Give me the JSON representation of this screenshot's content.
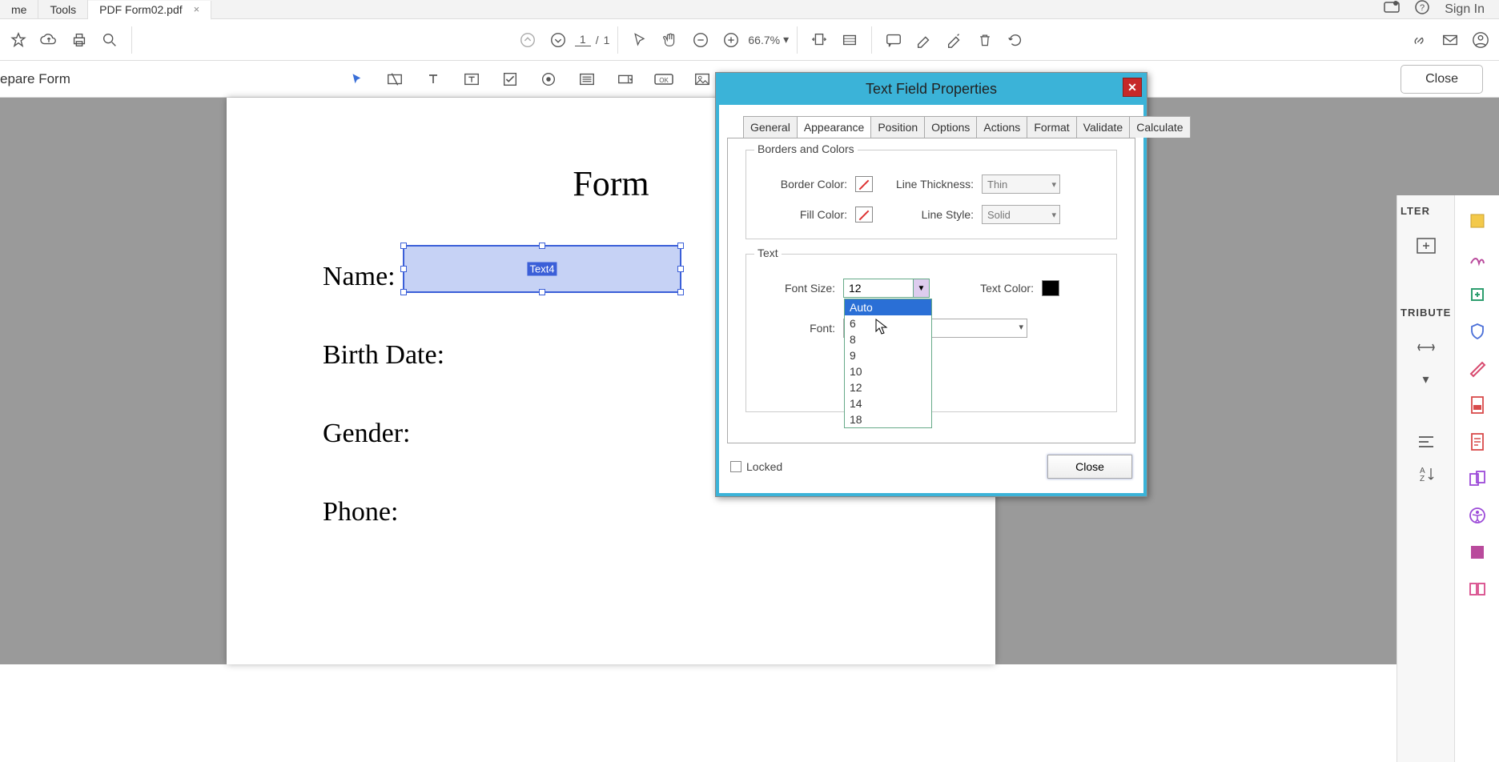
{
  "tabstrip": {
    "home": "me",
    "tools": "Tools",
    "file": "PDF Form02.pdf",
    "signin": "Sign In"
  },
  "toolbar": {
    "page_current": "1",
    "page_sep": "/",
    "page_total": "1",
    "zoom": "66.7%"
  },
  "prepbar": {
    "label": "epare Form",
    "close": "Close"
  },
  "document": {
    "title": "Form",
    "fields": {
      "name": "Name:",
      "birth": "Birth Date:",
      "gender": "Gender:",
      "phone": "Phone:"
    },
    "selected_field_tag": "Text4"
  },
  "rightpanel": {
    "hd1": "LTER",
    "hd2": "TRIBUTE"
  },
  "dialog": {
    "title": "Text Field Properties",
    "tabs": [
      "General",
      "Appearance",
      "Position",
      "Options",
      "Actions",
      "Format",
      "Validate",
      "Calculate"
    ],
    "active_tab": "Appearance",
    "borders_legend": "Borders and Colors",
    "border_color_label": "Border Color:",
    "fill_color_label": "Fill Color:",
    "line_thickness_label": "Line Thickness:",
    "line_thickness_value": "Thin",
    "line_style_label": "Line Style:",
    "line_style_value": "Solid",
    "text_legend": "Text",
    "font_size_label": "Font Size:",
    "font_size_value": "12",
    "font_size_options": [
      "Auto",
      "6",
      "8",
      "9",
      "10",
      "12",
      "14",
      "18"
    ],
    "text_color_label": "Text Color:",
    "font_label": "Font:",
    "locked_label": "Locked",
    "close": "Close"
  },
  "chart_data": null
}
